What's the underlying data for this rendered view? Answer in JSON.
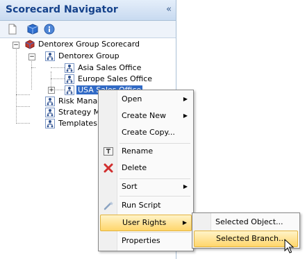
{
  "panel": {
    "title": "Scorecard Navigator",
    "collapse_glyph": "«",
    "toolbar": [
      {
        "name": "new-document-icon"
      },
      {
        "name": "cube-icon"
      },
      {
        "name": "info-icon"
      }
    ]
  },
  "tree": {
    "root": "Dentorex Group Scorecard",
    "group": "Dentorex Group",
    "offices": [
      "Asia Sales Office",
      "Europe Sales Office",
      "USA Sales Office"
    ],
    "siblings": [
      "Risk Management",
      "Strategy Map",
      "Templates"
    ],
    "visible_siblings": [
      "Risk Manag",
      "Strategy Ma",
      "Templates"
    ]
  },
  "context_menu": {
    "items": {
      "open": "Open",
      "create_new": "Create New",
      "create_copy": "Create Copy...",
      "rename": "Rename",
      "delete": "Delete",
      "sort": "Sort",
      "run_script": "Run Script",
      "user_rights": "User Rights",
      "properties": "Properties"
    },
    "arrow": "▶"
  },
  "submenu": {
    "selected_object": "Selected Object...",
    "selected_branch": "Selected Branch..."
  }
}
